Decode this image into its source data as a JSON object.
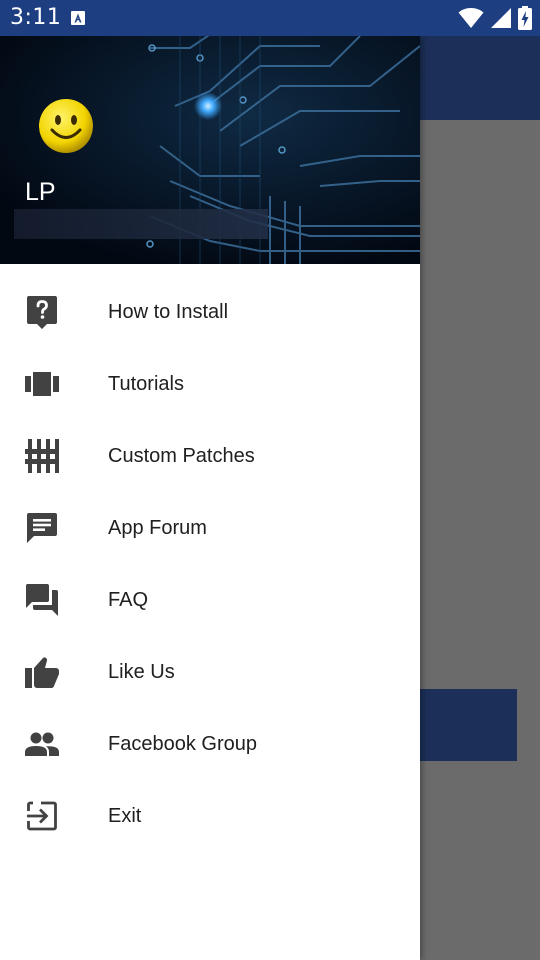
{
  "status_bar": {
    "time": "3:11",
    "notification_icon": "text-a-icon",
    "icons": [
      "wifi-icon",
      "signal-icon",
      "battery-charging-icon"
    ],
    "color": "#1d3f82"
  },
  "drawer": {
    "header": {
      "name": "LP",
      "avatar_icon": "smiley-face-icon",
      "background": "circuit-board-image"
    },
    "items": [
      {
        "label": "How to Install",
        "icon": "help-icon"
      },
      {
        "label": "Tutorials",
        "icon": "tutorials-icon"
      },
      {
        "label": "Custom Patches",
        "icon": "tune-icon"
      },
      {
        "label": "App Forum",
        "icon": "message-icon"
      },
      {
        "label": "FAQ",
        "icon": "forum-icon"
      },
      {
        "label": "Like Us",
        "icon": "thumb-up-icon"
      },
      {
        "label": "Facebook Group",
        "icon": "people-icon"
      },
      {
        "label": "Exit",
        "icon": "exit-icon"
      }
    ]
  },
  "colors": {
    "primary_dark": "#1d3f82",
    "primary": "#1c2f58",
    "scrim": "#6b6b6b",
    "icon": "#424242"
  }
}
